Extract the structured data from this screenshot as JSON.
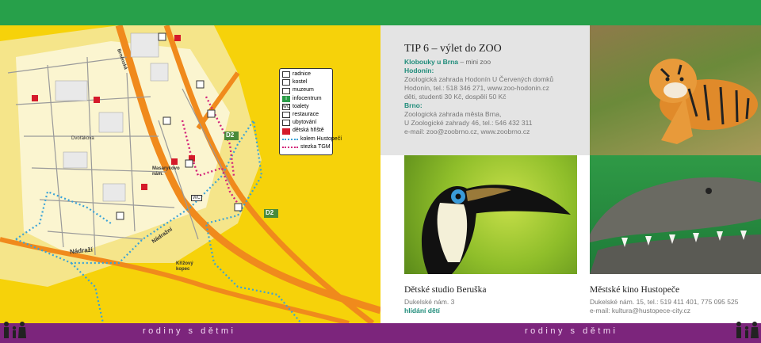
{
  "legend": {
    "items": [
      {
        "label": "radnice",
        "icon": "town-hall-icon"
      },
      {
        "label": "kostel",
        "icon": "church-icon"
      },
      {
        "label": "muzeum",
        "icon": "museum-icon"
      },
      {
        "label": "infocentrum",
        "icon": "info-icon"
      },
      {
        "label": "toalety",
        "icon": "toilet-icon"
      },
      {
        "label": "restaurace",
        "icon": "restaurant-icon"
      },
      {
        "label": "ubytování",
        "icon": "accommodation-icon"
      },
      {
        "label": "dětská hřiště",
        "icon": "playground-icon"
      },
      {
        "label": "kolem Hustopečí",
        "icon": "blue-dotted-route-icon"
      },
      {
        "label": "stezka TGM",
        "icon": "pink-dotted-route-icon"
      }
    ]
  },
  "map": {
    "road_badges": [
      "D2",
      "D2"
    ],
    "labels": {
      "station": "Nádraží",
      "station_street": "Nádražní",
      "hill": "Křížový kopec",
      "square": "Masarykovo nám.",
      "street_a": "Brněnská",
      "street_b": "Dvořákova",
      "wc": "WC"
    }
  },
  "tip": {
    "title": "TIP 6 – výlet do ZOO",
    "subtitle": "Klobouky u Brna",
    "subtitle_rest": " – mini zoo",
    "hodonin_heading": "Hodonín:",
    "hodonin_lines": [
      "Zoologická zahrada Hodonín U Červených domků",
      "Hodonín, tel.: 518 346 271, www.zoo-hodonin.cz",
      "děti, studenti 30 Kč, dospělí 50 Kč"
    ],
    "brno_heading": "Brno:",
    "brno_lines": [
      "Zoologická zahrada města Brna,",
      "U Zoologické zahrady 46, tel.: 546 432 311",
      "e-mail: zoo@zoobrno.cz, www.zoobrno.cz"
    ]
  },
  "studio": {
    "title": "Dětské studio Beruška",
    "address": "Dukelské nám. 3",
    "note": "hlídání dětí"
  },
  "kino": {
    "title": "Městské kino Hustopeče",
    "address": "Dukelské nám. 15, tel.: 519 411 401, 775 095 525",
    "email": "e-mail: kultura@hustopece-city.cz"
  },
  "footer": {
    "left": "rodiny s dětmi",
    "right": "rodiny s dětmi"
  },
  "colors": {
    "top_bar": "#27a04a",
    "footer": "#7c257c",
    "map_bg": "#f6d20a",
    "road": "#f08a1c",
    "teal_text": "#1f8c7a"
  },
  "photos": [
    "tiger-photo",
    "toucan-photo",
    "crocodile-photo"
  ]
}
